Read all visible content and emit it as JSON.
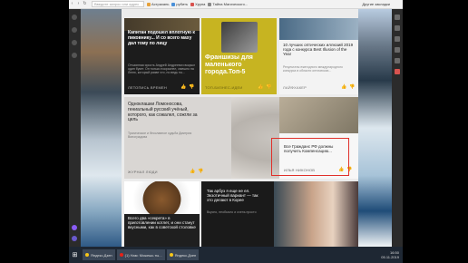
{
  "browser": {
    "address_placeholder": "Введите запрос или адрес",
    "bookmarks": [
      "Астрахань",
      "рубить",
      "Хрупа",
      "Тайна Магического..."
    ],
    "right_link": "Другие закладки"
  },
  "cards": [
    {
      "title": "Капитан подошел вплотную к пиковнику... И со всего маху дал тому по лицу",
      "desc": "Отчаянная ярость Андрей Андреевич вскрыл один букет. Он только покраснел, смешно на Лелю, который разве что, но ведь ты...",
      "source": "ЛЕТОПИСЬ ВРЕМЕН"
    },
    {
      "title": "Франшизы для маленького города.Топ-5",
      "desc": "",
      "source": "ТОП-БИЗНЕС-ИДЕИ"
    },
    {
      "title": "10 лучших оптических иллюзий 2019 года с конкурса Best Illusion of the Year",
      "desc": "Результаты ежегодного международного конкурса в области оптических...",
      "source": "ЛАЙФХАКЕР"
    },
    {
      "title": "Одноклашки Ломоносова, гениальный русский учёный, которого, как сожалел, сожгли за цель",
      "desc": "Трагическое и бесславное судьба Дмитрия Виноградова",
      "source": "ЖУРНАЛ ЛЮДИ"
    },
    {
      "title": "Все Гражданс РФ должны получить Компенсацию...",
      "desc": "",
      "source": "ИЛЬЯ НИКОНОВ"
    },
    {
      "title": "Всего два «секрета» в приготовлении котлет, и они станут вкусными, как в советской столовке",
      "desc": "",
      "source": ""
    },
    {
      "title": "Так арбуз я еще не ел. Экзотичный вариант — так это делают в Корее",
      "desc": "Вкусно, необычно и очень просто",
      "source": ""
    }
  ],
  "taskbar": {
    "tasks": [
      "Яндекс.Дзен",
      "(1) Нам: Можешь ты...",
      "Яндекс.Дзен"
    ],
    "time": "16:50",
    "date": "05.11.2019"
  },
  "colors": {
    "highlight": "#e0302a",
    "card_yellow": "#c7b421"
  }
}
